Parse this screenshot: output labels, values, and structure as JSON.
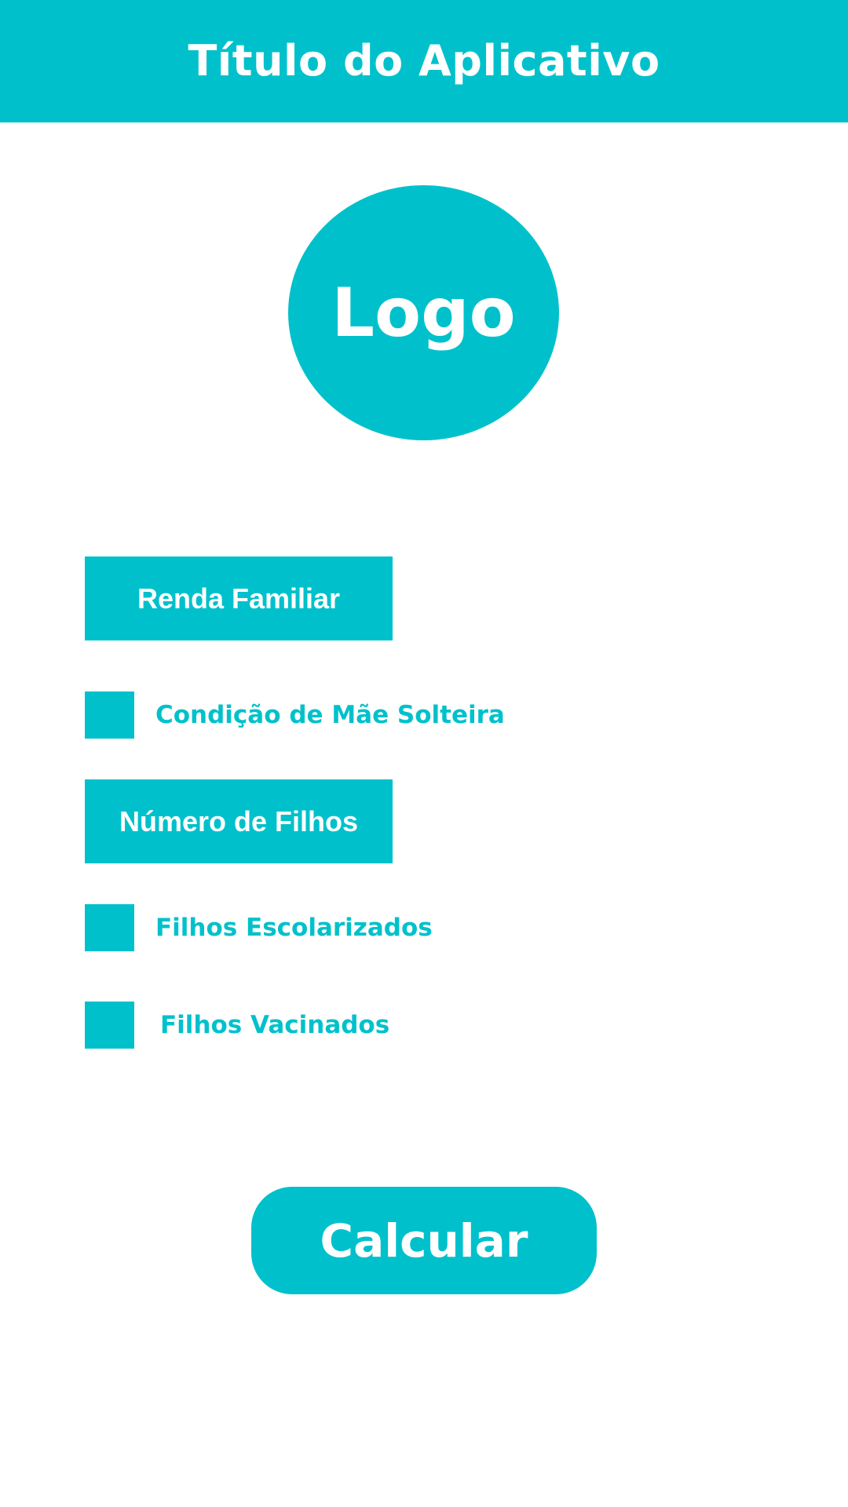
{
  "app": {
    "title": "Título do Aplicativo",
    "accent_color": "#00c1cb",
    "background_color": "#ffffff"
  },
  "logo": {
    "label": "Logo"
  },
  "form": {
    "renda_familiar": {
      "label": "Renda Familiar"
    },
    "mae_solteira": {
      "label": "Condição de Mãe Solteira",
      "checked": false
    },
    "numero_filhos": {
      "label": "Número de Filhos"
    },
    "filhos_escolarizados": {
      "label": "Filhos Escolarizados",
      "checked": false
    },
    "filhos_vacinados": {
      "label": "Filhos Vacinados",
      "checked": false
    }
  },
  "actions": {
    "calculate_label": "Calcular"
  }
}
